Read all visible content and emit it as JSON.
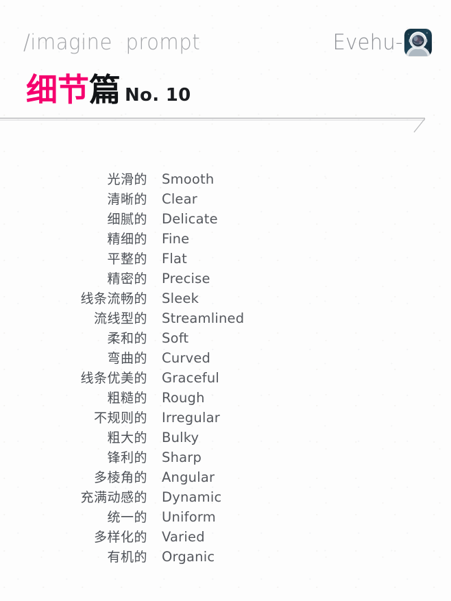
{
  "header": {
    "command_text": "/imagine  prompt",
    "brand_name": "Evehu-",
    "avatar_alt": "astronaut-avatar"
  },
  "title": {
    "cn_pink": "细节",
    "cn_dark": "篇",
    "number": "No. 10",
    "pink_color": "#f5006e",
    "dark_color": "#111316"
  },
  "divider": {
    "color": "#b8b9bc"
  },
  "list": {
    "rows": [
      {
        "cn": "光滑的",
        "en": "Smooth"
      },
      {
        "cn": "清晰的",
        "en": "Clear"
      },
      {
        "cn": "细腻的",
        "en": "Delicate"
      },
      {
        "cn": "精细的",
        "en": "Fine"
      },
      {
        "cn": "平整的",
        "en": "Flat"
      },
      {
        "cn": "精密的",
        "en": "Precise"
      },
      {
        "cn": "线条流畅的",
        "en": "Sleek"
      },
      {
        "cn": "流线型的",
        "en": "Streamlined"
      },
      {
        "cn": "柔和的",
        "en": "Soft"
      },
      {
        "cn": "弯曲的",
        "en": "Curved"
      },
      {
        "cn": "线条优美的",
        "en": "Graceful"
      },
      {
        "cn": "粗糙的",
        "en": "Rough"
      },
      {
        "cn": "不规则的",
        "en": "Irregular"
      },
      {
        "cn": "粗大的",
        "en": "Bulky"
      },
      {
        "cn": "锋利的",
        "en": "Sharp"
      },
      {
        "cn": "多棱角的",
        "en": "Angular"
      },
      {
        "cn": "充满动感的",
        "en": "Dynamic"
      },
      {
        "cn": "统一的",
        "en": "Uniform"
      },
      {
        "cn": "多样化的",
        "en": "Varied"
      },
      {
        "cn": "有机的",
        "en": "Organic"
      }
    ]
  }
}
